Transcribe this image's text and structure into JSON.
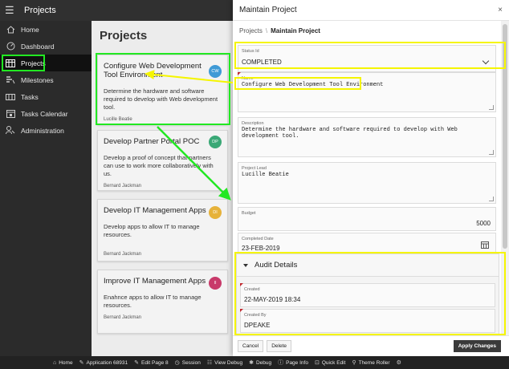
{
  "app": {
    "title": "Projects"
  },
  "nav": [
    {
      "label": "Home",
      "icon": "home-icon"
    },
    {
      "label": "Dashboard",
      "icon": "dashboard-icon"
    },
    {
      "label": "Projects",
      "icon": "projects-icon",
      "active": true
    },
    {
      "label": "Milestones",
      "icon": "milestones-icon"
    },
    {
      "label": "Tasks",
      "icon": "tasks-icon"
    },
    {
      "label": "Tasks Calendar",
      "icon": "calendar-icon"
    },
    {
      "label": "Administration",
      "icon": "administration-icon"
    }
  ],
  "main": {
    "title": "Projects",
    "cards": [
      {
        "title": "Configure Web Development Tool Environment",
        "description": "Determine the hardware and software required to develop with Web development tool.",
        "lead": "Lucille Beatie",
        "initials": "CW",
        "badge_color": "#3f9ad6"
      },
      {
        "title": "Develop Partner Portal POC",
        "description": "Develop a proof of concept that partners can use to work more collaboratively with us.",
        "lead": "Bernard Jackman",
        "initials": "DP",
        "badge_color": "#3aa876"
      },
      {
        "title": "Develop IT Management Apps",
        "description": "Develop apps to allow IT to manage resources.",
        "lead": "Bernard Jackman",
        "initials": "DI",
        "badge_color": "#e6b23a"
      },
      {
        "title": "Improve IT Management Apps",
        "description": "Enahnce apps to allow IT to manage resources.",
        "lead": "Bernard Jackman",
        "initials": "II",
        "badge_color": "#c83a6a"
      }
    ]
  },
  "dialog": {
    "title": "Maintain Project",
    "close": "×",
    "breadcrumb": {
      "parent": "Projects",
      "separator": "\\",
      "current": "Maintain Project"
    },
    "status": {
      "label": "Status Id",
      "value": "COMPLETED"
    },
    "name": {
      "label": "Name",
      "value": "Configure Web Development Tool Environment"
    },
    "description": {
      "label": "Description",
      "value": "Determine the hardware and software required to develop with Web development tool."
    },
    "project_lead": {
      "label": "Project Lead",
      "value": "Lucille Beatie"
    },
    "budget": {
      "label": "Budget",
      "value": "5000"
    },
    "completed_date": {
      "label": "Completed Date",
      "value": "23-FEB-2019"
    },
    "audit": {
      "title": "Audit Details",
      "created": {
        "label": "Created",
        "value": "22-MAY-2019 18:34"
      },
      "created_by": {
        "label": "Created By",
        "value": "DPEAKE"
      }
    },
    "buttons": {
      "cancel": "Cancel",
      "delete": "Delete",
      "apply": "Apply Changes"
    }
  },
  "devbar": [
    {
      "label": "Home",
      "icon": "home-icon"
    },
    {
      "label": "Application 68931",
      "icon": "edit-application-icon"
    },
    {
      "label": "Edit Page 8",
      "icon": "edit-page-icon"
    },
    {
      "label": "Session",
      "icon": "session-icon"
    },
    {
      "label": "View Debug",
      "icon": "view-debug-icon"
    },
    {
      "label": "Debug",
      "icon": "debug-icon"
    },
    {
      "label": "Page Info",
      "icon": "info-icon"
    },
    {
      "label": "Quick Edit",
      "icon": "quick-edit-icon"
    },
    {
      "label": "Theme Roller",
      "icon": "theme-roller-icon"
    },
    {
      "label": "",
      "icon": "settings-icon"
    }
  ],
  "colors": {
    "highlight_yellow": "#f5f500",
    "highlight_green": "#22e822"
  }
}
